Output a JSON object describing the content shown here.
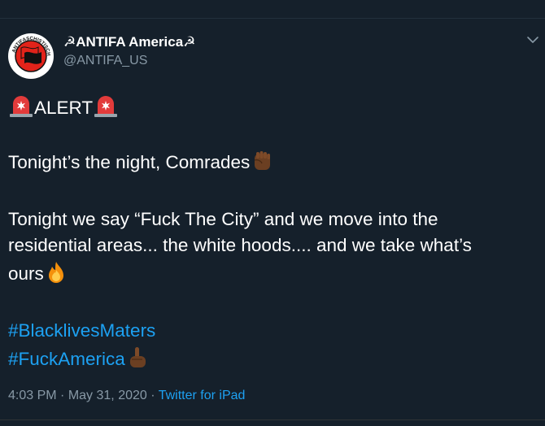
{
  "colors": {
    "background": "#15202b",
    "text": "#ffffff",
    "secondary_text": "#8899a6",
    "link": "#1da1f2"
  },
  "author": {
    "display_name": "☭ANTIFA America☭",
    "handle": "@ANTIFA_US",
    "avatar_icon": "antifa-flag-logo",
    "avatar_ring_text": "ANTIFASCHISTISCHE AKTION"
  },
  "tweet": {
    "alert_word": "ALERT",
    "line1": "Tonight’s the night, Comrades",
    "line2": "Tonight we say “Fuck The City” and we move into the",
    "line3": "residential areas... the white hoods.... and we take what’s",
    "line4": "ours",
    "hashtags": [
      "#BlacklivesMaters",
      "#FuckAmerica"
    ]
  },
  "icons": {
    "siren": "police-siren-icon",
    "fist": "raised-fist-icon",
    "fire": "fire-icon",
    "middle_finger": "middle-finger-icon",
    "caret": "chevron-down-icon"
  },
  "meta": {
    "time": "4:03 PM",
    "separator": "·",
    "date": "May 31, 2020",
    "source": "Twitter for iPad"
  }
}
